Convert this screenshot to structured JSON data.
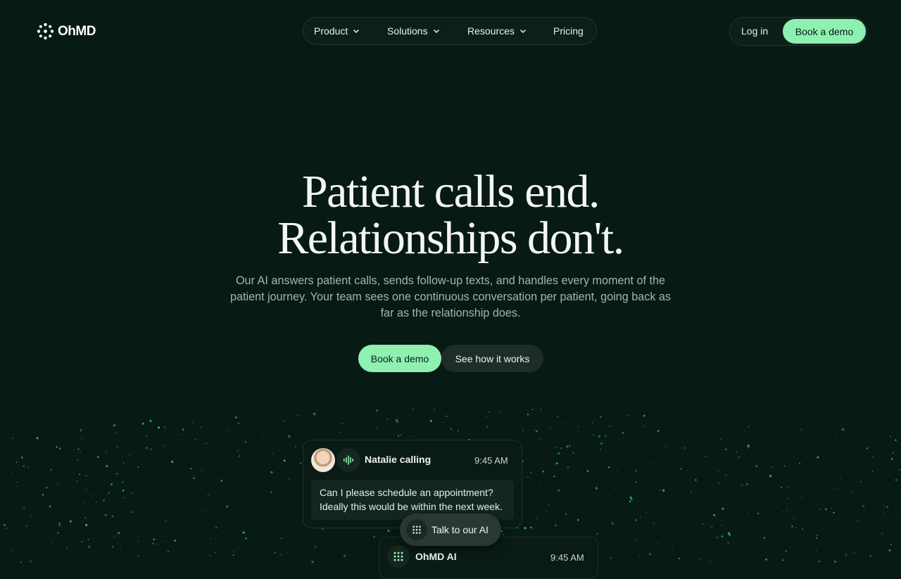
{
  "brand": {
    "name": "OhMD"
  },
  "nav": {
    "items": [
      {
        "label": "Product",
        "has_dropdown": true
      },
      {
        "label": "Solutions",
        "has_dropdown": true
      },
      {
        "label": "Resources",
        "has_dropdown": true
      },
      {
        "label": "Pricing",
        "has_dropdown": false
      }
    ],
    "login_label": "Log in",
    "demo_label": "Book a demo"
  },
  "hero": {
    "title_line1": "Patient calls end.",
    "title_line2": "Relationships don't.",
    "subtitle": "Our AI answers patient calls, sends follow-up texts, and handles every moment of the patient journey. Your team sees one continuous conversation per patient, going back as far as the relationship does.",
    "primary_cta": "Book a demo",
    "secondary_cta": "See how it works"
  },
  "call_card": {
    "caller": "Natalie calling",
    "time": "9:45 AM",
    "message": "Can I please schedule an appointment? Ideally this would be within the next week."
  },
  "talk_button": {
    "label": "Talk to our AI"
  },
  "ai_card": {
    "name": "OhMD AI",
    "time": "9:45 AM"
  },
  "colors": {
    "background": "#071a13",
    "accent": "#8ef0b1",
    "dot": "#3ddc84"
  }
}
